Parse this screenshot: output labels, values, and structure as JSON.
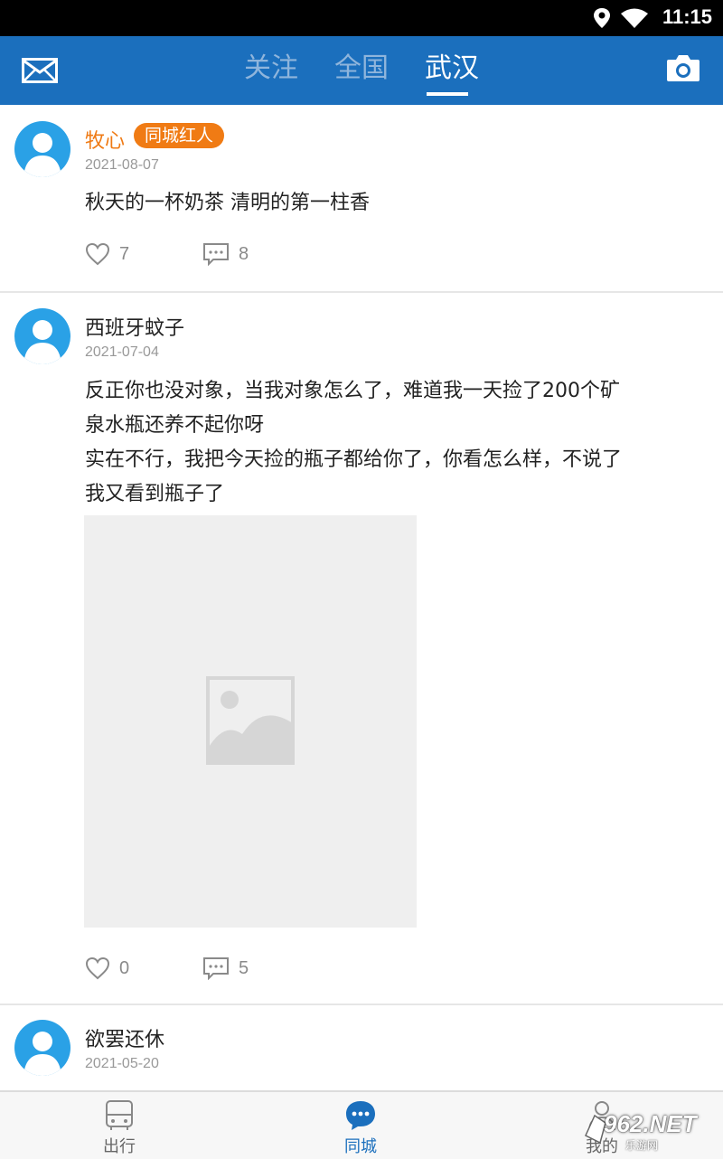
{
  "status_bar": {
    "time": "11:15"
  },
  "header": {
    "tabs": [
      {
        "label": "关注"
      },
      {
        "label": "全国"
      },
      {
        "label": "武汉"
      }
    ],
    "active_tab": "武汉"
  },
  "posts": [
    {
      "username": "牧心",
      "badge": "同城红人",
      "date": "2021-08-07",
      "content": "秋天的一杯奶茶 清明的第一柱香",
      "likes": "7",
      "comments": "8"
    },
    {
      "username": "西班牙蚊子",
      "date": "2021-07-04",
      "content_lines": [
        "反正你也没对象，当我对象怎么了，难道我一天捡了200个矿",
        "泉水瓶还养不起你呀",
        "实在不行，我把今天捡的瓶子都给你了，你看怎么样，不说了",
        "我又看到瓶子了"
      ],
      "likes": "0",
      "comments": "5"
    },
    {
      "username": "欲罢还休",
      "date": "2021-05-20"
    }
  ],
  "bottom_nav": [
    {
      "label": "出行"
    },
    {
      "label": "同城"
    },
    {
      "label": "我的"
    }
  ],
  "watermark": {
    "text": "962.NET",
    "sub": "乐游网"
  },
  "colors": {
    "brand": "#1b6fbd",
    "badge": "#f07b14",
    "username_highlight": "#ef7a14"
  }
}
